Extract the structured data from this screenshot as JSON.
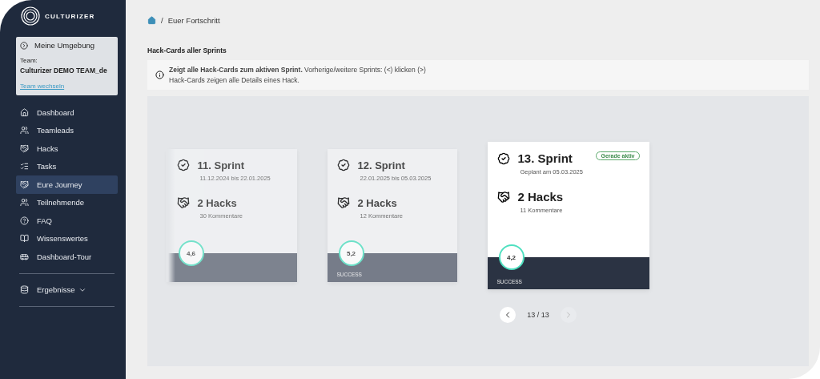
{
  "sidebar": {
    "logo_text": "CULTURIZER",
    "environment": {
      "title": "Meine Umgebung",
      "team_label": "Team:",
      "team_name": "Culturizer DEMO TEAM_de",
      "switch_link": "Team wechseln"
    },
    "items": [
      {
        "label": "Dashboard",
        "selected": false
      },
      {
        "label": "Teamleads",
        "selected": false
      },
      {
        "label": "Hacks",
        "selected": false
      },
      {
        "label": "Tasks",
        "selected": false
      },
      {
        "label": "Eure Journey",
        "selected": true
      },
      {
        "label": "Teilnehmende",
        "selected": false
      },
      {
        "label": "FAQ",
        "selected": false
      },
      {
        "label": "Wissenswertes",
        "selected": false
      },
      {
        "label": "Dashboard-Tour",
        "selected": false
      }
    ],
    "results": {
      "label": "Ergebnisse",
      "expanded": false
    }
  },
  "breadcrumb": {
    "separator": "/",
    "items": [
      "Euer Fortschritt"
    ]
  },
  "section_title": "Hack-Cards aller Sprints",
  "info": {
    "text": "**Zeigt alle Hack-Cards zum aktiven Sprint.** Vorherige/weitere Sprints: (<) klicken (>)",
    "subtext": "Hack-Cards zeigen alle Details eines Hack."
  },
  "cards": [
    {
      "kind": "faded",
      "title": "11. Sprint",
      "date": "11.12.2024 bis 22.01.2025",
      "hacks": "2 Hacks",
      "comments": "30 Kommentare",
      "score": "4,6",
      "active": false
    },
    {
      "kind": "past",
      "title": "12. Sprint",
      "date": "22.01.2025 bis 05.03.2025",
      "hacks": "2 Hacks",
      "comments": "12 Kommentare",
      "score": "5,2",
      "score_label": "SUCCESS",
      "active": false
    },
    {
      "kind": "current",
      "title": "13. Sprint",
      "badge": "Gerade aktiv",
      "date": "Geplant am 05.03.2025",
      "hacks": "2 Hacks",
      "comments": "11 Kommentare",
      "score": "4,2",
      "score_label": "SUCCESS",
      "active": true
    }
  ],
  "pager": {
    "text": "13 / 13",
    "prev_disabled": false,
    "next_disabled": true
  }
}
